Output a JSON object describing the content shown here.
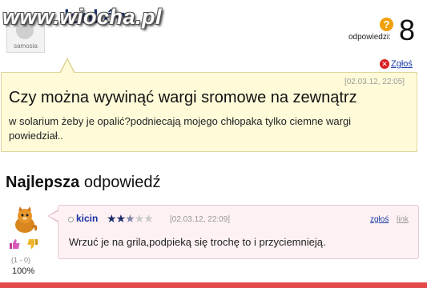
{
  "header": {
    "user_title": "...lonków",
    "watermark": "www.wiocha.pl",
    "avatar_caption": "samosia",
    "question_icon": "?",
    "answers_label": "odpowiedzi:",
    "answers_count": "8",
    "report_label": "Zgłoś"
  },
  "question": {
    "date": "[02.03.12, 22:05]",
    "title": "Czy można wywinąć wargi sromowe na zewnątrz",
    "body": "w solarium żeby je opalić?podniecają mojego chłopaka tylko ciemne wargi powiedział.."
  },
  "best_answer": {
    "heading_bold": "Najlepsza",
    "heading_rest": " odpowiedź",
    "user": "kicin",
    "rating": 2.5,
    "rating_max": 5,
    "date": "[02.03.12, 22:09]",
    "report_label": "zgłoś",
    "link_label": "link",
    "text": "Wrzuć je na grila,podpieką się trochę to i przyciemnieją.",
    "votes": "(1 - 0)",
    "percent": "100%"
  },
  "colors": {
    "accent_blue": "#1a2fa8",
    "question_bg": "#fffbd9",
    "answer_bg": "#fdf1f3",
    "report_red": "#d82020",
    "stars_on": "#1d2c6b"
  },
  "icons": [
    "question-icon",
    "report-x-icon",
    "thumbs-up-icon",
    "thumbs-down-icon",
    "star-icon",
    "online-dot-icon"
  ]
}
